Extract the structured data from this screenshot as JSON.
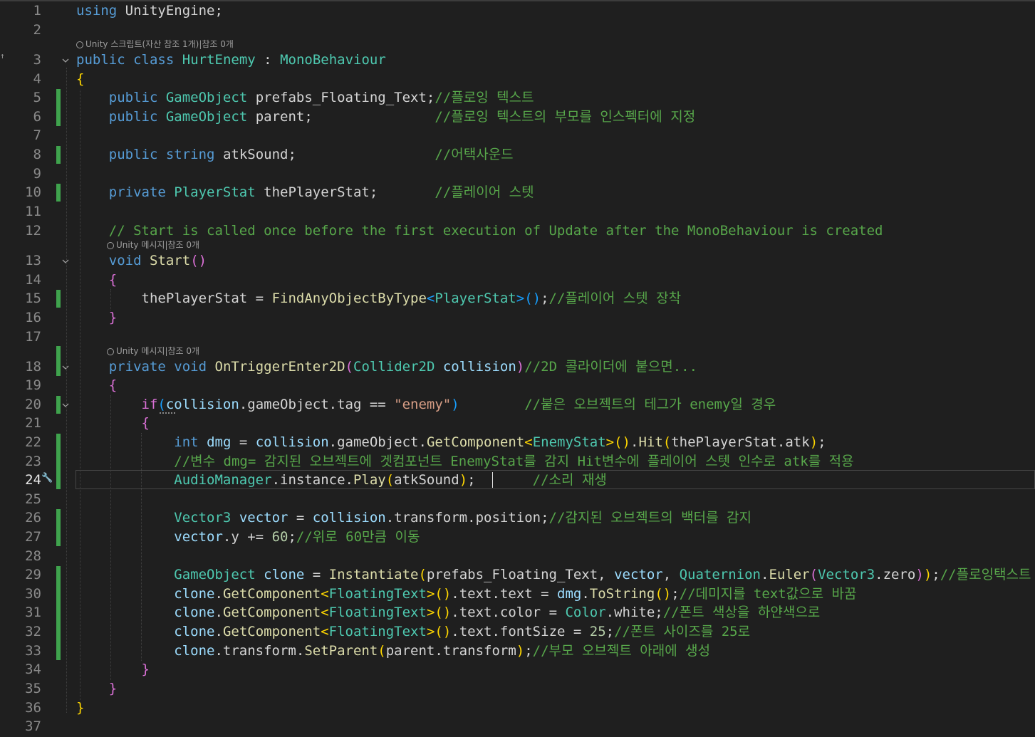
{
  "editor": {
    "language": "C#",
    "active_line": 24,
    "line_numbers": [
      "1",
      "2",
      "3",
      "4",
      "5",
      "6",
      "7",
      "8",
      "9",
      "10",
      "11",
      "12",
      "13",
      "14",
      "15",
      "16",
      "17",
      "18",
      "19",
      "20",
      "21",
      "22",
      "23",
      "24",
      "25",
      "26",
      "27",
      "28",
      "29",
      "30",
      "31",
      "32",
      "33",
      "34",
      "35",
      "36",
      "37"
    ],
    "code_lens": [
      "Unity 스크립트(자산 참조 1개)|참조 0개",
      "Unity 메시지|참조 0개",
      "Unity 메시지|참조 0개"
    ],
    "code": {
      "l1_using": "using",
      "l1_ns": "UnityEngine;",
      "l3_public": "public",
      "l3_class": "class",
      "l3_name": "HurtEnemy",
      "l3_colon": ":",
      "l3_base": "MonoBehaviour",
      "l4_brace": "{",
      "l5_public": "public",
      "l5_type": "GameObject",
      "l5_name": "prefabs_Floating_Text;",
      "l5_comment": "//플로잉 텍스트",
      "l6_public": "public",
      "l6_type": "GameObject",
      "l6_name": "parent;",
      "l6_comment": "//플로잉 텍스트의 부모를 인스펙터에 지정",
      "l8_public": "public",
      "l8_type": "string",
      "l8_name": "atkSound;",
      "l8_comment": "//어택사운드",
      "l10_private": "private",
      "l10_type": "PlayerStat",
      "l10_name": "thePlayerStat;",
      "l10_comment": "//플레이어 스텟",
      "l12_comment": "// Start is called once before the first execution of Update after the MonoBehaviour is created",
      "l13_void": "void",
      "l13_fn": "Start",
      "l13_parens": "()",
      "l14_brace": "{",
      "l15_var": "thePlayerStat",
      "l15_eq": " = ",
      "l15_fn": "FindAnyObjectByType",
      "l15_lt": "<",
      "l15_type": "PlayerStat",
      "l15_gt": ">",
      "l15_parens": "()",
      "l15_semi": ";",
      "l15_comment": "//플레이어 스텟 장착",
      "l16_brace": "}",
      "l18_private": "private",
      "l18_void": "void",
      "l18_fn": "OnTriggerEnter2D",
      "l18_open": "(",
      "l18_type": "Collider2D",
      "l18_param": "collision",
      "l18_close": ")",
      "l18_comment": "//2D 콜라이더에 붙으면...",
      "l19_brace": "{",
      "l20_if": "if",
      "l20_open": "(",
      "l20_var": "collision",
      "l20_member": ".gameObject.tag == ",
      "l20_string": "\"enemy\"",
      "l20_close": ")",
      "l20_comment": "//붙은 오브젝트의 테그가 enemy일 경우",
      "l21_brace": "{",
      "l22_int": "int",
      "l22_var": "dmg",
      "l22_eq": " = ",
      "l22_obj": "collision",
      "l22_dot1": ".gameObject.",
      "l22_fn": "GetComponent",
      "l22_lt": "<",
      "l22_type": "EnemyStat",
      "l22_gt": ">",
      "l22_parens": "()",
      "l22_dot2": ".",
      "l22_fn2": "Hit",
      "l22_open": "(",
      "l22_arg": "thePlayerStat.atk",
      "l22_close": ")",
      "l22_semi": ";",
      "l23_comment": "//변수 dmg= 감지된 오브젝트에 겟컴포넌트 EnemyStat를 감지 Hit변수에 플레이어 스텟 인수로 atk를 적용",
      "l24_type": "AudioManager",
      "l24_mid": ".instance.",
      "l24_fn": "Play",
      "l24_open": "(",
      "l24_arg": "atkSound",
      "l24_close": ")",
      "l24_semi": ";",
      "l24_comment": "//소리 재생",
      "l26_type": "Vector3",
      "l26_var": "vector",
      "l26_eq": " = ",
      "l26_obj": "collision",
      "l26_rest": ".transform.position;",
      "l26_comment": "//감지된 오브젝트의 백터를 감지",
      "l27_var": "vector",
      "l27_mid": ".y += ",
      "l27_num": "60",
      "l27_semi": ";",
      "l27_comment": "//위로 60만큼 이동",
      "l29_type": "GameObject",
      "l29_var": "clone",
      "l29_eq": " = ",
      "l29_fn": "Instantiate",
      "l29_open": "(",
      "l29_arg1": "prefabs_Floating_Text",
      "l29_comma1": ", ",
      "l29_arg2": "vector",
      "l29_comma2": ", ",
      "l29_type2": "Quaternion",
      "l29_dot": ".",
      "l29_fn2": "Euler",
      "l29_open2": "(",
      "l29_type3": "Vector3",
      "l29_zero": ".zero",
      "l29_close2": ")",
      "l29_close": ")",
      "l29_semi": ";",
      "l29_comment": "//플로잉택스트 생성",
      "l30_var": "clone",
      "l30_dot": ".",
      "l30_fn": "GetComponent",
      "l30_lt": "<",
      "l30_type": "FloatingText",
      "l30_gt": ">",
      "l30_parens": "()",
      "l30_mid": ".text.text = ",
      "l30_var2": "dmg",
      "l30_dot2": ".",
      "l30_fn2": "ToString",
      "l30_parens2": "()",
      "l30_semi": ";",
      "l30_comment": "//데미지를 text값으로 바꿈",
      "l31_var": "clone",
      "l31_dot": ".",
      "l31_fn": "GetComponent",
      "l31_lt": "<",
      "l31_type": "FloatingText",
      "l31_gt": ">",
      "l31_parens": "()",
      "l31_mid": ".text.color = ",
      "l31_type2": "Color",
      "l31_rest": ".white;",
      "l31_comment": "//폰트 색상을 하얀색으로",
      "l32_var": "clone",
      "l32_dot": ".",
      "l32_fn": "GetComponent",
      "l32_lt": "<",
      "l32_type": "FloatingText",
      "l32_gt": ">",
      "l32_parens": "()",
      "l32_mid": ".text.fontSize = ",
      "l32_num": "25",
      "l32_semi": ";",
      "l32_comment": "//폰트 사이즈를 25로",
      "l33_var": "clone",
      "l33_mid": ".transform.",
      "l33_fn": "SetParent",
      "l33_open": "(",
      "l33_arg": "parent.transform",
      "l33_close": ")",
      "l33_semi": ";",
      "l33_comment": "//부모 오브젝트 아래에 생성",
      "l34_brace": "}",
      "l35_brace": "}",
      "l36_brace": "}"
    }
  },
  "icons": {
    "fold": "chevron-down-icon",
    "lens": "unity-icon",
    "quick_action": "wrench-icon",
    "nav": "arrow-icon"
  },
  "colors": {
    "background": "#1f1f1f",
    "keyword": "#569cd6",
    "type": "#4ec9b0",
    "method": "#dcdcaa",
    "comment": "#57a64a",
    "string": "#d69d85",
    "variable": "#9cdcfe",
    "change_bar": "#3fa34d"
  }
}
